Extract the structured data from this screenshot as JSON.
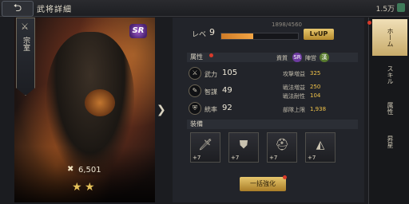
{
  "header": {
    "title": "武将詳細",
    "currency": "1.5万"
  },
  "portrait": {
    "banner_text": "宗室",
    "rarity": "SR",
    "power": "6,501",
    "stars": 2
  },
  "level": {
    "label": "レベ",
    "value": "9",
    "exp_text": "1898/4560",
    "progress": 0.42,
    "lvup_label": "LvUP"
  },
  "attributes": {
    "header": "属性",
    "quality_label": "資質",
    "camp_label": "陣営",
    "stats": [
      {
        "name": "武力",
        "value": "105"
      },
      {
        "name": "智謀",
        "value": "49"
      },
      {
        "name": "統率",
        "value": "92"
      }
    ],
    "sub_stats": [
      {
        "name": "攻撃増益",
        "value": "325"
      },
      {
        "name": "戦法増益",
        "value": "250"
      },
      {
        "name": "戦法耐性",
        "value": "104"
      },
      {
        "name": "部隊上限",
        "value": "1,938"
      }
    ]
  },
  "equipment": {
    "header": "装備",
    "items": [
      {
        "name": "weapon",
        "plus": "+7"
      },
      {
        "name": "armor",
        "plus": "+7"
      },
      {
        "name": "helmet",
        "plus": "+7"
      },
      {
        "name": "cloak",
        "plus": "+7"
      }
    ],
    "enhance_label": "一括強化"
  },
  "tabs": [
    {
      "label": "ホーム",
      "active": true
    },
    {
      "label": "スキル",
      "active": false
    },
    {
      "label": "属性",
      "active": false
    },
    {
      "label": "昇星",
      "active": false
    }
  ]
}
